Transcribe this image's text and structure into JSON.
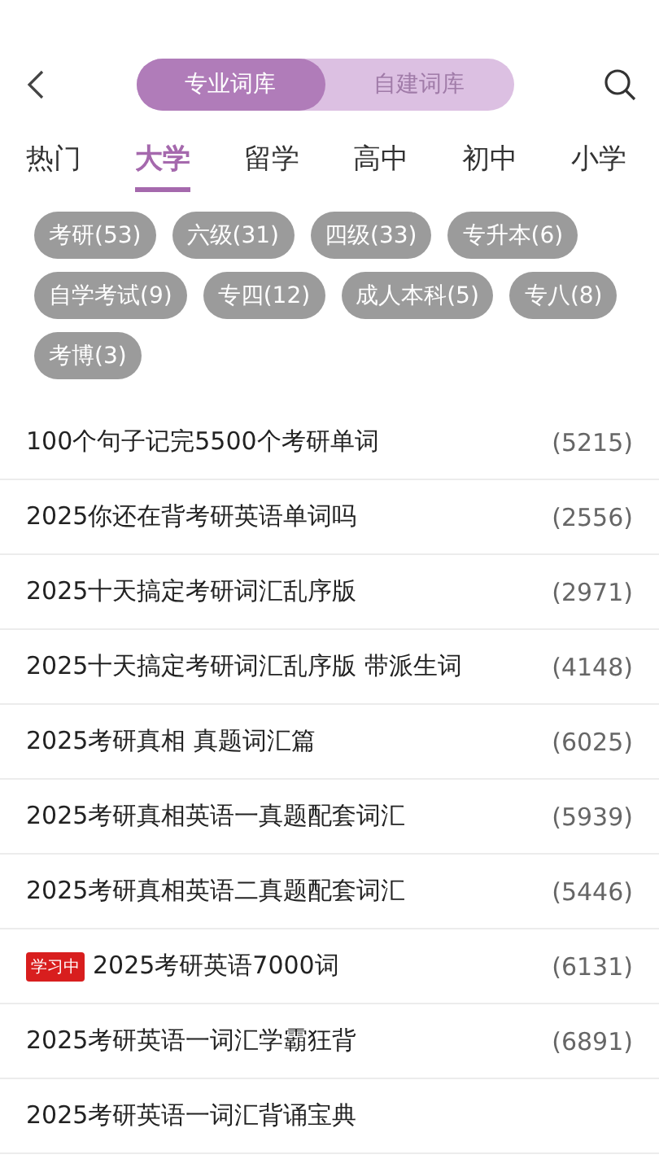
{
  "segment": [
    {
      "label": "专业词库",
      "selected": true
    },
    {
      "label": "自建词库",
      "selected": false
    }
  ],
  "categories": [
    {
      "label": "热门",
      "selected": false
    },
    {
      "label": "大学",
      "selected": true
    },
    {
      "label": "留学",
      "selected": false
    },
    {
      "label": "高中",
      "selected": false
    },
    {
      "label": "初中",
      "selected": false
    },
    {
      "label": "小学",
      "selected": false
    }
  ],
  "tags": [
    "考研(53)",
    "六级(31)",
    "四级(33)",
    "专升本(6)",
    "自学考试(9)",
    "专四(12)",
    "成人本科(5)",
    "专八(8)",
    "考博(3)"
  ],
  "books": [
    {
      "title": "100个句子记完5500个考研单词",
      "count": "(5215)"
    },
    {
      "title": "2025你还在背考研英语单词吗",
      "count": "(2556)"
    },
    {
      "title": "2025十天搞定考研词汇乱序版",
      "count": "(2971)"
    },
    {
      "title": "2025十天搞定考研词汇乱序版 带派生词",
      "count": "(4148)"
    },
    {
      "title": "2025考研真相 真题词汇篇",
      "count": "(6025)"
    },
    {
      "title": "2025考研真相英语一真题配套词汇",
      "count": "(5939)"
    },
    {
      "title": "2025考研真相英语二真题配套词汇",
      "count": "(5446)"
    },
    {
      "title": "2025考研英语7000词",
      "count": "(6131)",
      "badge": "学习中"
    },
    {
      "title": "2025考研英语一词汇学霸狂背",
      "count": "(6891)"
    },
    {
      "title": "2025考研英语一词汇背诵宝典"
    }
  ]
}
